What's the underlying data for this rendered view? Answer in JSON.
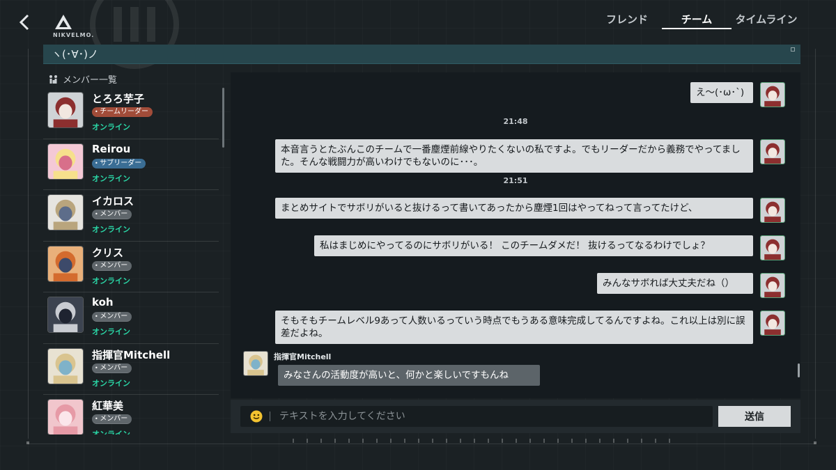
{
  "app": {
    "logo_text": "NIKVELMO.",
    "team_name": "ヽ(･∀･)ノ"
  },
  "nav": {
    "back_icon": "chevron-left-icon",
    "tabs": [
      {
        "label": "フレンド",
        "active": false
      },
      {
        "label": "チーム",
        "active": true
      },
      {
        "label": "タイムライン",
        "active": false
      }
    ]
  },
  "members": {
    "header": "メンバー一覧",
    "items": [
      {
        "name": "とろろ芋子",
        "role": "チームリーダー",
        "role_type": "leader",
        "status": "オンライン",
        "avatar_colors": [
          "#cfd3d6",
          "#8c2f2f",
          "#f2e7e0"
        ]
      },
      {
        "name": "Reirou",
        "role": "サブリーダー",
        "role_type": "sub",
        "status": "オンライン",
        "avatar_colors": [
          "#f4c9d6",
          "#f6e08c",
          "#d86f8a"
        ]
      },
      {
        "name": "イカロス",
        "role": "メンバー",
        "role_type": "member",
        "status": "オンライン",
        "avatar_colors": [
          "#e6e4df",
          "#b9a57d",
          "#5d6d8a"
        ]
      },
      {
        "name": "クリス",
        "role": "メンバー",
        "role_type": "member",
        "status": "オンライン",
        "avatar_colors": [
          "#e9b07a",
          "#d46b2e",
          "#3d4a6a"
        ]
      },
      {
        "name": "koh",
        "role": "メンバー",
        "role_type": "member",
        "status": "オンライン",
        "avatar_colors": [
          "#3c4350",
          "#c9ccd2",
          "#1e2330"
        ]
      },
      {
        "name": "指揮官Mitchell",
        "role": "メンバー",
        "role_type": "member",
        "status": "オンライン",
        "avatar_colors": [
          "#e8e2d2",
          "#d9c48f",
          "#7fb2c9"
        ]
      },
      {
        "name": "紅華美",
        "role": "メンバー",
        "role_type": "member",
        "status": "オンライン",
        "avatar_colors": [
          "#f1c6cc",
          "#e69aa6",
          "#fbe6ea"
        ]
      }
    ]
  },
  "chat": {
    "messages": [
      {
        "side": "right",
        "text": "え〜(･ω･`)"
      },
      {
        "type": "time",
        "text": "21:48"
      },
      {
        "side": "right",
        "text": "本音言うとたぶんこのチームで一番塵煙前線やりたくないの私ですよ。でもリーダーだから義務でやってました。そんな戦闘力が高いわけでもないのに･･･。"
      },
      {
        "type": "time",
        "text": "21:51"
      },
      {
        "side": "right",
        "text": "まとめサイトでサボリがいると抜けるって書いてあったから塵煙1回はやってねって言ってたけど、"
      },
      {
        "side": "right",
        "text": "私はまじめにやってるのにサボリがいる！ このチームダメだ！ 抜けるってなるわけでしょ？"
      },
      {
        "side": "right",
        "text": "みんなサボれば大丈夫だね（）"
      },
      {
        "side": "right",
        "text": "そもそもチームレベル9あって人数いるっていう時点でもうある意味完成してるんですよね。これ以上は別に誤差だよね。"
      },
      {
        "side": "left",
        "sender": "指揮官Mitchell",
        "text": "みなさんの活動度が高いと、何かと楽しいですもんね"
      }
    ],
    "input_placeholder": "テキストを入力してください",
    "send_label": "送信",
    "emoji_icon": "smiley-face-icon"
  },
  "colors": {
    "online": "#2ad6a6",
    "leader_badge": "#a14c39",
    "sub_badge": "#3a6d94",
    "member_badge": "#5f666b",
    "team_bar": "#27464d"
  }
}
